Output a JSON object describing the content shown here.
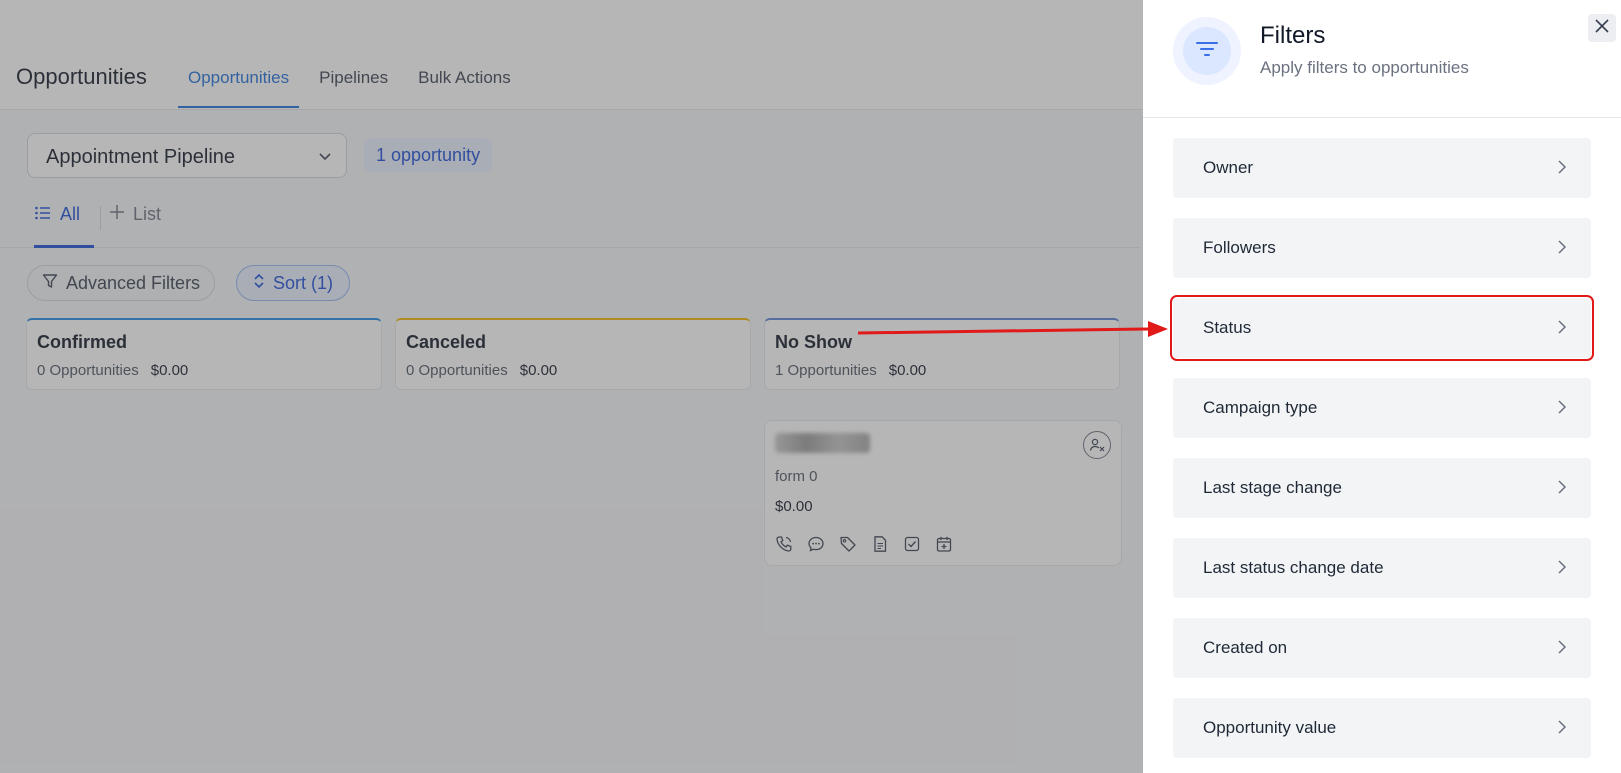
{
  "app": {
    "page_title": "Opportunities",
    "tabs": [
      {
        "label": "Opportunities",
        "active": true
      },
      {
        "label": "Pipelines",
        "active": false
      },
      {
        "label": "Bulk Actions",
        "active": false
      }
    ],
    "pipeline_select": {
      "value": "Appointment Pipeline"
    },
    "opportunity_count": "1 opportunity",
    "view_tabs": {
      "all": "All",
      "list": "List"
    },
    "toolbar": {
      "advanced_filters": "Advanced Filters",
      "sort": "Sort (1)"
    },
    "stages": [
      {
        "name": "Confirmed",
        "count": "0 Opportunities",
        "value": "$0.00",
        "color": "#1e88e5"
      },
      {
        "name": "Canceled",
        "count": "0 Opportunities",
        "value": "$0.00",
        "color": "#f4b400"
      },
      {
        "name": "No Show",
        "count": "1 Opportunities",
        "value": "$0.00",
        "color": "#5b7fd6"
      }
    ],
    "card": {
      "source": "form 0",
      "value": "$0.00"
    }
  },
  "drawer": {
    "title": "Filters",
    "subtitle": "Apply filters to opportunities",
    "items": [
      {
        "label": "Owner"
      },
      {
        "label": "Followers"
      },
      {
        "label": "Status",
        "highlighted": true
      },
      {
        "label": "Campaign type"
      },
      {
        "label": "Last stage change"
      },
      {
        "label": "Last status change date"
      },
      {
        "label": "Created on"
      },
      {
        "label": "Opportunity value"
      }
    ]
  },
  "colors": {
    "accent": "#1d4ed8",
    "highlight": "#e11919"
  }
}
